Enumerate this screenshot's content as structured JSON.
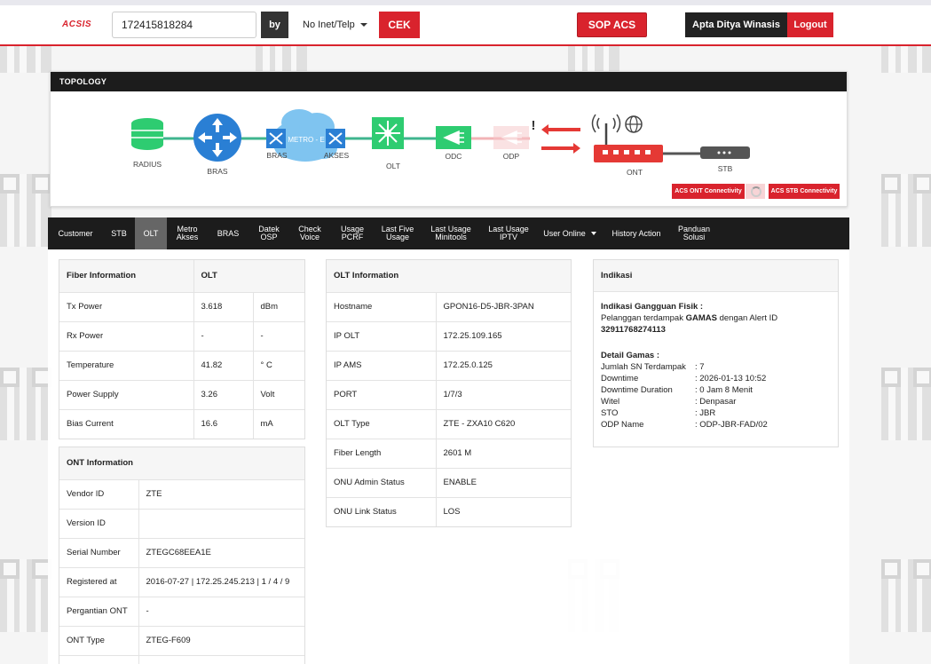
{
  "header": {
    "logo": "ACSIS",
    "search_value": "172415818284",
    "by_label": "by",
    "search_type": "No Inet/Telp",
    "cek_label": "CEK",
    "sop_label": "SOP ACS",
    "user_name": "Apta Ditya Winasis",
    "logout_label": "Logout"
  },
  "topology": {
    "title": "TOPOLOGY",
    "nodes": {
      "radius": "RADIUS",
      "bras": "BRAS",
      "bras2": "BRAS",
      "metro": "METRO - E",
      "akses": "AKSES",
      "olt": "OLT",
      "odc": "ODC",
      "odp": "ODP",
      "ont": "ONT",
      "stb": "STB"
    },
    "alert_mark": "!",
    "acs_ont_label": "ACS ONT Connectivity",
    "acs_stb_label": "ACS STB Connectivity",
    "colors": {
      "line": "#3fb58e",
      "node_green": "#2ecc71",
      "node_blue": "#2a7fd4",
      "cloud": "#7fc4f0",
      "alert": "#e53935"
    }
  },
  "tabs": [
    {
      "label": "Customer"
    },
    {
      "label": "STB"
    },
    {
      "label": "OLT",
      "active": true
    },
    {
      "label": "Metro\nAkses"
    },
    {
      "label": "BRAS"
    },
    {
      "label": "Datek\nOSP"
    },
    {
      "label": "Check\nVoice"
    },
    {
      "label": "Usage\nPCRF"
    },
    {
      "label": "Last Five\nUsage"
    },
    {
      "label": "Last Usage\nMinitools"
    },
    {
      "label": "Last Usage\nIPTV"
    },
    {
      "label": "User Online"
    },
    {
      "label": "History Action"
    },
    {
      "label": "Panduan\nSolusi"
    }
  ],
  "fiber": {
    "head1": "Fiber Information",
    "head2": "OLT",
    "rows": [
      {
        "label": "Tx Power",
        "value": "3.618",
        "unit": "dBm"
      },
      {
        "label": "Rx Power",
        "value": "-",
        "unit": "-"
      },
      {
        "label": "Temperature",
        "value": "41.82",
        "unit": "° C"
      },
      {
        "label": "Power Supply",
        "value": "3.26",
        "unit": "Volt"
      },
      {
        "label": "Bias Current",
        "value": "16.6",
        "unit": "mA"
      }
    ]
  },
  "ont": {
    "head": "ONT Information",
    "rows": [
      {
        "label": "Vendor ID",
        "value": "ZTE"
      },
      {
        "label": "Version ID",
        "value": ""
      },
      {
        "label": "Serial Number",
        "value": "ZTEGC68EEA1E"
      },
      {
        "label": "Registered at",
        "value": "2016-07-27 | 172.25.245.213 | 1 / 4 / 9"
      },
      {
        "label": "Pergantian ONT",
        "value": "-"
      },
      {
        "label": "ONT Type",
        "value": "ZTEG-F609"
      }
    ]
  },
  "olt": {
    "head": "OLT Information",
    "rows": [
      {
        "label": "Hostname",
        "value": "GPON16-D5-JBR-3PAN"
      },
      {
        "label": "IP OLT",
        "value": "172.25.109.165"
      },
      {
        "label": "IP AMS",
        "value": "172.25.0.125"
      },
      {
        "label": "PORT",
        "value": "1/7/3"
      },
      {
        "label": "OLT Type",
        "value": "ZTE - ZXA10 C620"
      },
      {
        "label": "Fiber Length",
        "value": "2601 M"
      },
      {
        "label": "ONU Admin Status",
        "value": "ENABLE"
      },
      {
        "label": "ONU Link Status",
        "value": "LOS"
      }
    ]
  },
  "indikasi": {
    "head": "Indikasi",
    "gangguan_title": "Indikasi Gangguan Fisik :",
    "gangguan_text_1": "Pelanggan terdampak ",
    "gangguan_bold": "GAMAS",
    "gangguan_text_2": " dengan Alert ID",
    "alert_id": "32911768274113",
    "detail_title": "Detail Gamas :",
    "details": [
      {
        "k": "Jumlah SN Terdampak",
        "v": ": 7"
      },
      {
        "k": "Downtime",
        "v": ": 2026-01-13 10:52"
      },
      {
        "k": "Downtime Duration",
        "v": ": 0 Jam 8 Menit"
      },
      {
        "k": "Witel",
        "v": ": Denpasar"
      },
      {
        "k": "STO",
        "v": ": JBR"
      },
      {
        "k": "ODP Name",
        "v": ": ODP-JBR-FAD/02"
      }
    ]
  }
}
